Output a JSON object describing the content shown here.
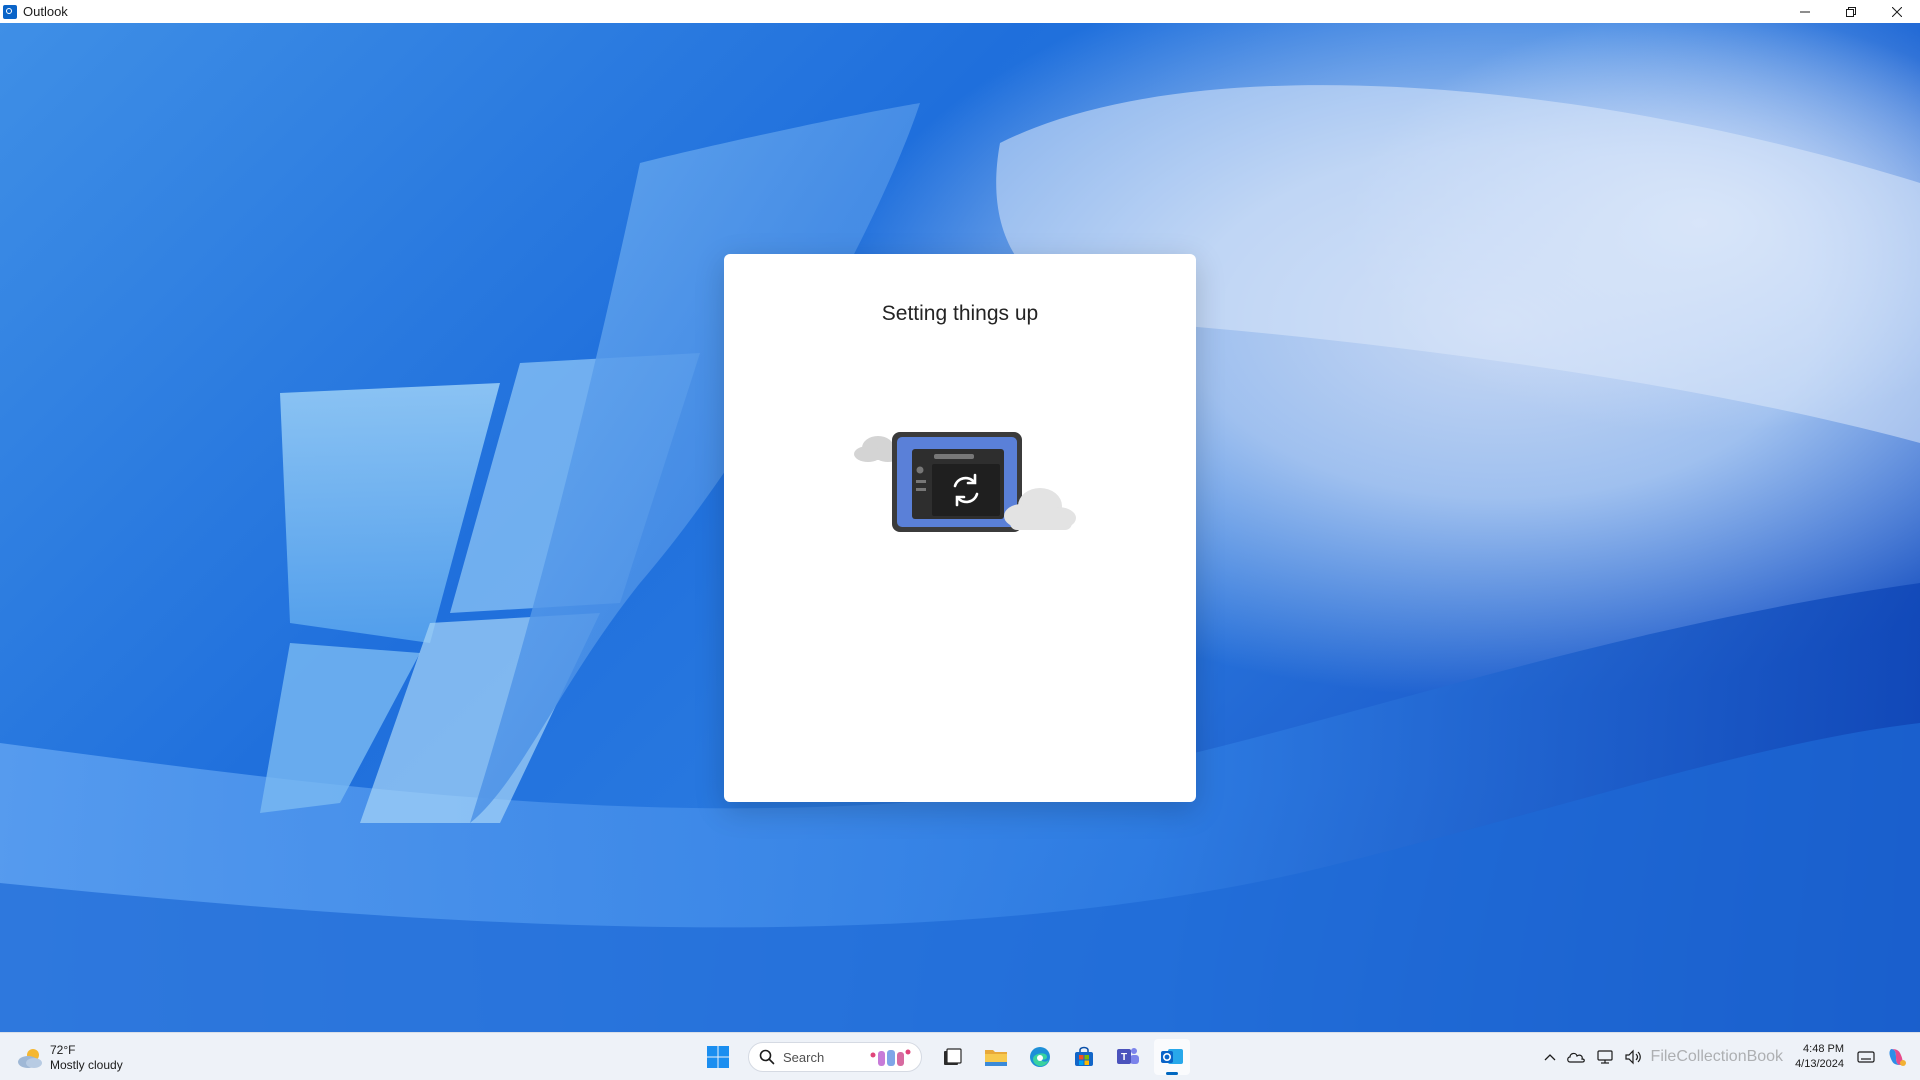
{
  "window": {
    "title": "Outlook",
    "controls": {
      "minimize": "–",
      "restore": "❐",
      "close": "✕"
    }
  },
  "dialog": {
    "title": "Setting things up",
    "illustration": "device-sync-illustration"
  },
  "taskbar": {
    "weather": {
      "temperature": "72°F",
      "condition": "Mostly cloudy",
      "icon": "cloud-sun-icon"
    },
    "search": {
      "label": "Search"
    },
    "pinned": [
      "start-icon",
      "search",
      "task-view-icon",
      "file-explorer-icon",
      "edge-icon",
      "store-icon",
      "teams-icon",
      "outlook-icon"
    ],
    "tray": {
      "time": "4:48 PM",
      "date": "4/13/2024",
      "watermark": "FileCollectionBook"
    }
  },
  "colors": {
    "accent": "#0067c0",
    "dialog_bg": "#ffffff",
    "taskbar_bg": "#eef2f8"
  }
}
